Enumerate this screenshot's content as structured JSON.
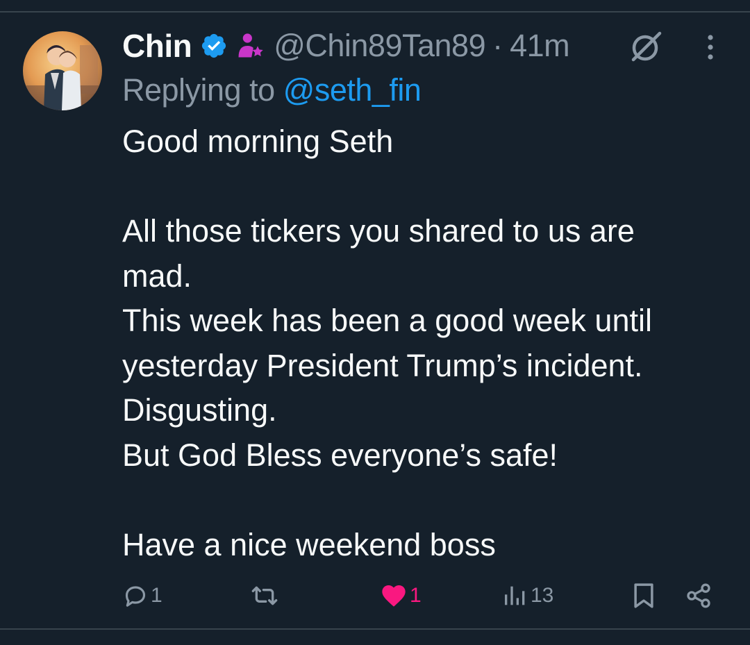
{
  "tweet": {
    "author": {
      "display_name": "Chin",
      "handle": "@Chin89Tan89",
      "verified": true,
      "verified_color": "#1d9bf0",
      "affiliate_badge": "person-star-icon",
      "affiliate_color": "#c936c9"
    },
    "separator": "·",
    "time": "41m",
    "grok_icon": "grok-icon",
    "more_icon": "more-options-icon",
    "replying": {
      "prefix": "Replying to ",
      "mention": "@seth_fin"
    },
    "text_lines": [
      "Good morning Seth",
      "",
      "All those tickers you shared to us are",
      "mad.",
      "This week has been a good week until",
      "yesterday President Trump’s incident.",
      "Disgusting.",
      "But God Bless everyone’s safe!",
      "",
      "Have a nice weekend boss"
    ],
    "actions": {
      "replies": "1",
      "retweets": "",
      "likes": "1",
      "views": "13",
      "like_color": "#f91880"
    }
  }
}
